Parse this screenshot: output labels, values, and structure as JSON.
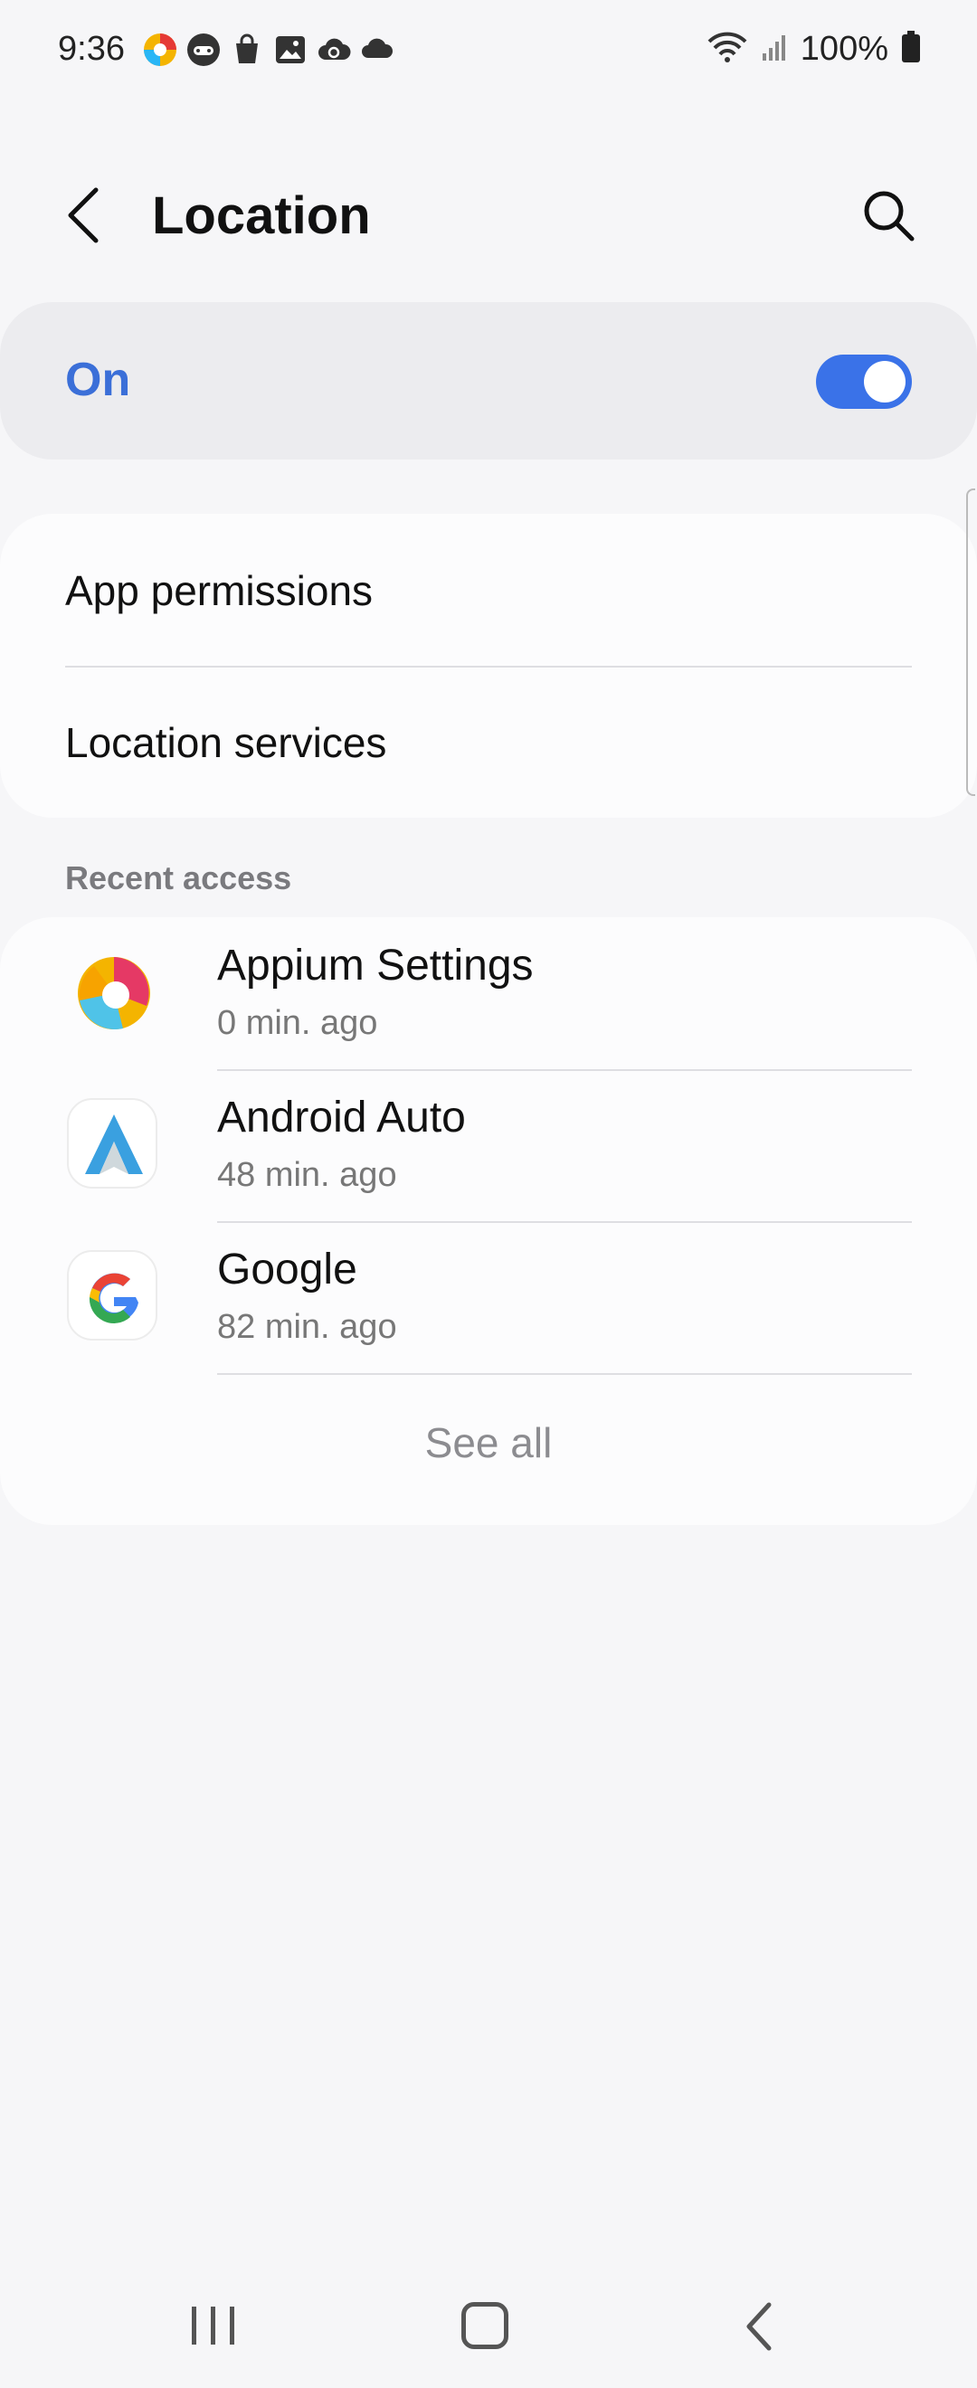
{
  "status_bar": {
    "time": "9:36",
    "battery": "100%",
    "notification_icons": [
      "appium-icon",
      "game-icon",
      "shopping-bag-icon",
      "gallery-icon",
      "cloud-sync-icon",
      "cloud-icon"
    ],
    "system_icons": [
      "wifi-icon",
      "signal-icon",
      "battery-icon"
    ]
  },
  "header": {
    "title": "Location",
    "back_icon": "back-arrow-icon",
    "search_icon": "search-icon"
  },
  "location_toggle": {
    "label": "On",
    "checked": true,
    "accent_color": "#3a72e8",
    "label_color": "#3b6fd8"
  },
  "settings": {
    "items": [
      {
        "label": "App permissions"
      },
      {
        "label": "Location services"
      }
    ]
  },
  "recent_access": {
    "section_label": "Recent access",
    "apps": [
      {
        "name": "Appium Settings",
        "time": "0 min. ago",
        "icon": "appium-settings-icon"
      },
      {
        "name": "Android Auto",
        "time": "48 min. ago",
        "icon": "android-auto-icon"
      },
      {
        "name": "Google",
        "time": "82 min. ago",
        "icon": "google-icon"
      }
    ],
    "see_all": "See all"
  },
  "nav_bar": {
    "items": [
      "recents-icon",
      "home-icon",
      "back-icon"
    ]
  }
}
